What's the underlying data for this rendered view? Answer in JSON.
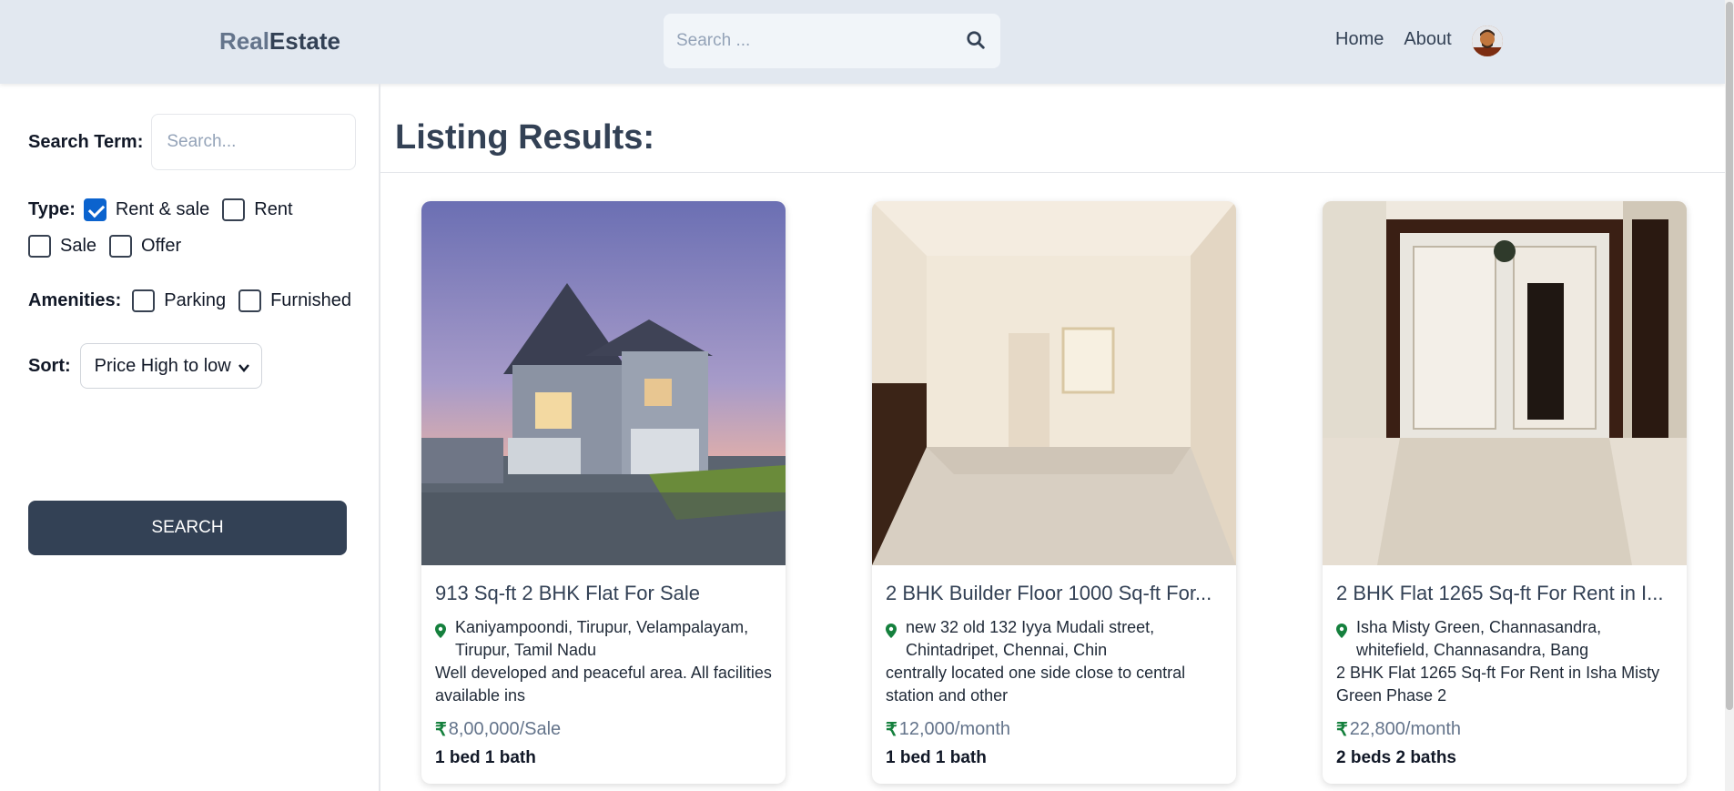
{
  "header": {
    "logo_part1": "Real",
    "logo_part2": "Estate",
    "search_placeholder": "Search ...",
    "nav": [
      "Home",
      "About"
    ]
  },
  "sidebar": {
    "search_term_label": "Search Term:",
    "search_term_placeholder": "Search...",
    "type_label": "Type:",
    "type_options": [
      {
        "label": "Rent & sale",
        "checked": true
      },
      {
        "label": "Rent",
        "checked": false
      },
      {
        "label": "Sale",
        "checked": false
      },
      {
        "label": "Offer",
        "checked": false
      }
    ],
    "amenities_label": "Amenities:",
    "amenities_options": [
      {
        "label": "Parking",
        "checked": false
      },
      {
        "label": "Furnished",
        "checked": false
      }
    ],
    "sort_label": "Sort:",
    "sort_value": "Price High to low",
    "search_button": "SEARCH"
  },
  "main": {
    "title": "Listing Results:",
    "listings": [
      {
        "title": "913 Sq-ft 2 BHK Flat For Sale",
        "address": "Kaniyampoondi, Tirupur, Velampalayam, Tirupur, Tamil Nadu",
        "description": "Well developed and peaceful area. All facilities available ins",
        "price": "8,00,000/Sale",
        "beds_baths": "1 bed  1 bath"
      },
      {
        "title": "2 BHK Builder Floor 1000 Sq-ft For...",
        "address": "new 32 old 132 Iyya Mudali street, Chintadripet, Chennai, Chin",
        "description": "centrally located one side close to central station and other",
        "price": "12,000/month",
        "beds_baths": "1 bed  1 bath"
      },
      {
        "title": "2 BHK Flat 1265 Sq-ft For Rent in I...",
        "address": "Isha Misty Green, Channasandra, whitefield, Channasandra, Bang",
        "description": "2 BHK Flat 1265 Sq-ft For Rent in Isha Misty Green Phase 2",
        "price": "22,800/month",
        "beds_baths": "2 beds  2 baths"
      }
    ]
  },
  "icons": {
    "search": "search-icon",
    "location": "map-pin-icon",
    "currency": "rupee-icon",
    "dropdown": "chevron-down-icon"
  },
  "colors": {
    "header_bg": "#e2e8f0",
    "button_bg": "#334155",
    "checkbox_checked": "#0b63ce",
    "pin_green": "#15803d"
  }
}
